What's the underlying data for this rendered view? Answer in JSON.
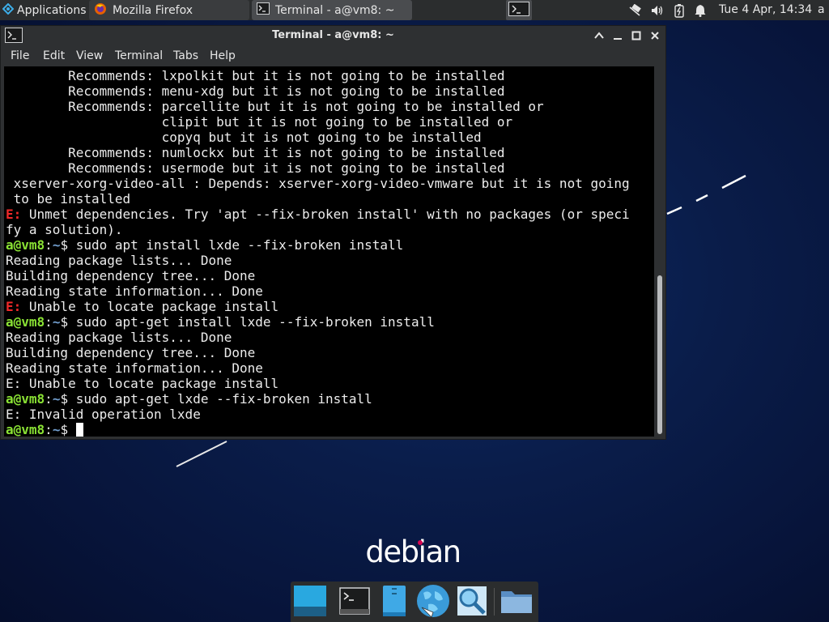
{
  "panel": {
    "applications_label": "Applications",
    "tasks": [
      {
        "label": "Mozilla Firefox",
        "icon": "firefox-icon"
      },
      {
        "label": "Terminal - a@vm8: ~",
        "icon": "terminal-icon"
      }
    ],
    "clock": "Tue  4 Apr, 14:34",
    "user": "a",
    "tray_icons": [
      "network-icon",
      "volume-icon",
      "battery-icon",
      "notifications-icon"
    ]
  },
  "window": {
    "title": "Terminal - a@vm8: ~",
    "menu": [
      "File",
      "Edit",
      "View",
      "Terminal",
      "Tabs",
      "Help"
    ]
  },
  "terminal": {
    "user_host": "a@vm8",
    "path": "~",
    "lines": [
      {
        "text": "        Recommends: lxpolkit but it is not going to be installed"
      },
      {
        "text": "        Recommends: menu-xdg but it is not going to be installed"
      },
      {
        "text": "        Recommends: parcellite but it is not going to be installed or"
      },
      {
        "text": "                    clipit but it is not going to be installed or"
      },
      {
        "text": "                    copyq but it is not going to be installed"
      },
      {
        "text": "        Recommends: numlockx but it is not going to be installed"
      },
      {
        "text": "        Recommends: usermode but it is not going to be installed"
      },
      {
        "text": " xserver-xorg-video-all : Depends: xserver-xorg-video-vmware but it is not going"
      },
      {
        "text": " to be installed"
      },
      {
        "err": "E:",
        "text": " Unmet dependencies. Try 'apt --fix-broken install' with no packages (or speci"
      },
      {
        "text": "fy a solution)."
      },
      {
        "prompt": true,
        "text": " sudo apt install lxde --fix-broken install"
      },
      {
        "text": "Reading package lists... Done"
      },
      {
        "text": "Building dependency tree... Done"
      },
      {
        "text": "Reading state information... Done"
      },
      {
        "err": "E:",
        "text": " Unable to locate package install"
      },
      {
        "prompt": true,
        "text": " sudo apt-get install lxde --fix-broken install"
      },
      {
        "text": "Reading package lists... Done"
      },
      {
        "text": "Building dependency tree... Done"
      },
      {
        "text": "Reading state information... Done"
      },
      {
        "text": "E: Unable to locate package install"
      },
      {
        "prompt": true,
        "text": " sudo apt-get lxde --fix-broken install"
      },
      {
        "text": "E: Invalid operation lxde"
      },
      {
        "prompt": true,
        "text": " ",
        "cursor": true
      }
    ]
  },
  "desktop": {
    "logo_text": "debian"
  },
  "dock": {
    "items": [
      "show-desktop-icon",
      "terminal-icon",
      "file-manager-icon",
      "web-browser-icon",
      "app-finder-icon",
      "folder-icon"
    ]
  },
  "colors": {
    "panel_bg": "#2b2d2e",
    "terminal_bg": "#000000",
    "error_red": "#ef2929",
    "prompt_green": "#8ae234",
    "path_blue": "#729fcf",
    "debian_red": "#d70751"
  }
}
